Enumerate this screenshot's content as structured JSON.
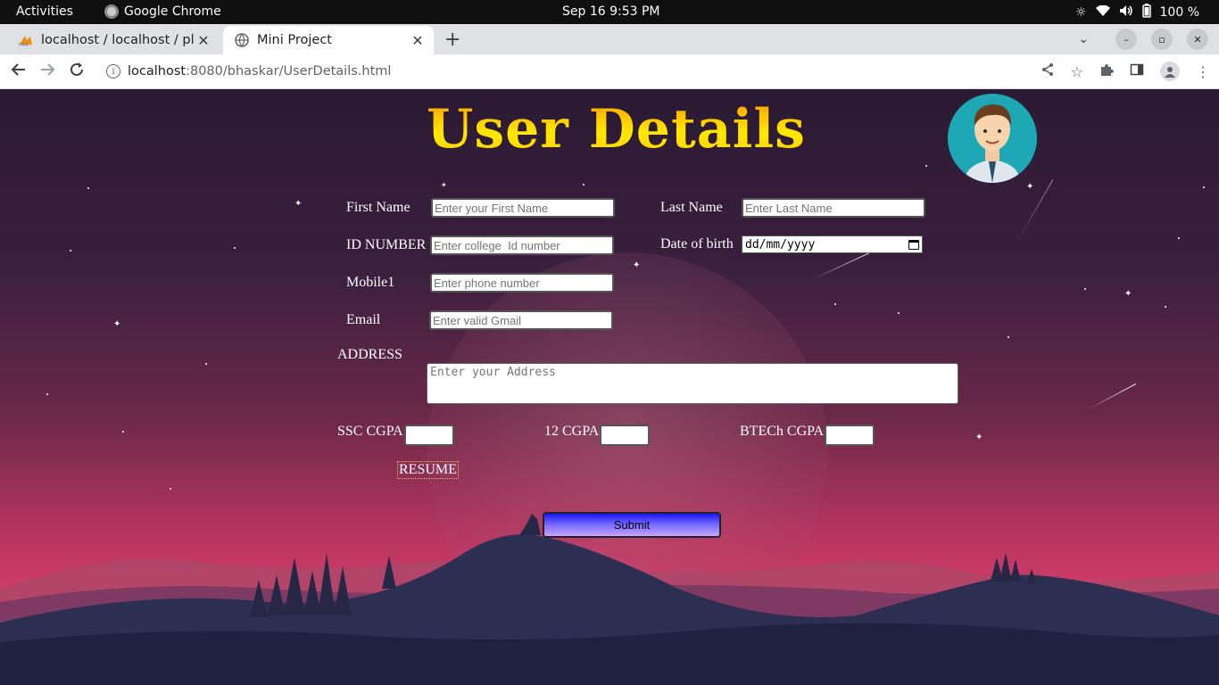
{
  "system_bar": {
    "activities": "Activities",
    "app_name": "Google Chrome",
    "clock": "Sep 16  9:53 PM",
    "battery": "100 %"
  },
  "browser": {
    "tabs": [
      {
        "title": "localhost / localhost / plac",
        "active": false
      },
      {
        "title": "Mini Project",
        "active": true
      }
    ],
    "url_host": "localhost",
    "url_path": ":8080/bhaskar/UserDetails.html"
  },
  "page": {
    "heading": "User Details",
    "form": {
      "first_name": {
        "label": "First Name",
        "placeholder": "Enter your First Name"
      },
      "last_name": {
        "label": "Last Name",
        "placeholder": "Enter Last Name"
      },
      "id_number": {
        "label": "ID NUMBER",
        "placeholder": "Enter college  Id number"
      },
      "dob": {
        "label": "Date of birth",
        "placeholder": "dd/mm/yyyy"
      },
      "mobile": {
        "label": "Mobile1",
        "placeholder": "Enter phone number"
      },
      "email": {
        "label": "Email",
        "placeholder": "Enter valid Gmail"
      },
      "address": {
        "label": "ADDRESS",
        "placeholder": "Enter your Address"
      },
      "ssc": {
        "label": "SSC CGPA"
      },
      "twelfth": {
        "label": "12 CGPA"
      },
      "btech": {
        "label": "BTECh CGPA"
      },
      "resume": "RESUME",
      "submit": "Submit"
    }
  },
  "colors": {
    "heading_gradient_top": "#ff9a00",
    "heading_gradient_bottom": "#ffe800",
    "submit_gradient_top": "#1818ff",
    "submit_gradient_bottom": "#c6a4ff",
    "sky_top": "#2a1a33",
    "sky_bottom": "#d8406a"
  }
}
